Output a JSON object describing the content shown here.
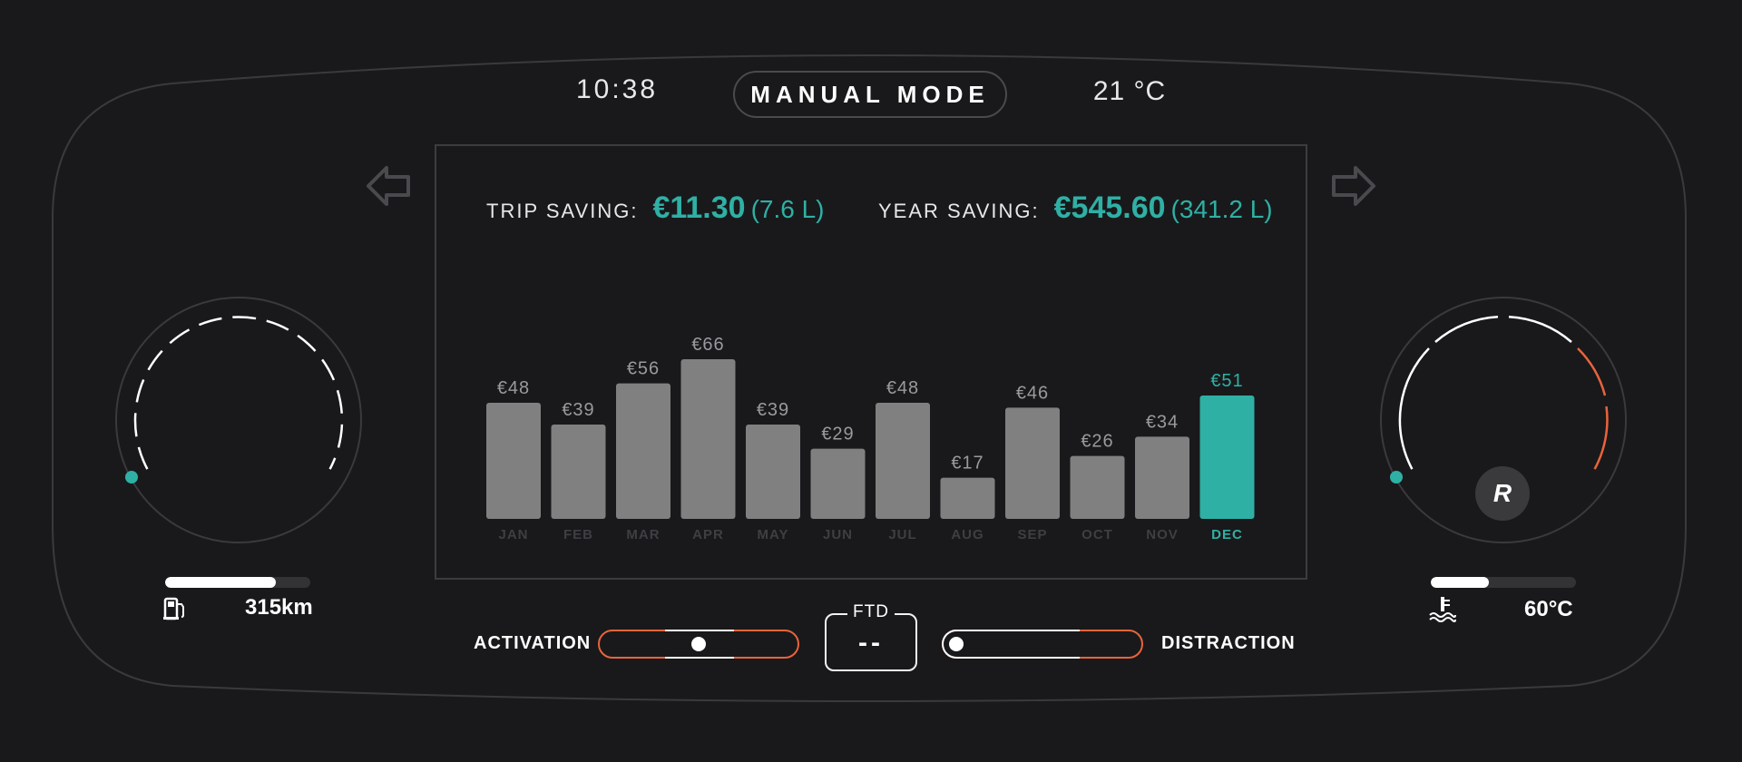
{
  "header": {
    "time": "10:38",
    "mode": "MANUAL MODE",
    "temperature": "21 °C"
  },
  "savings": {
    "trip_label": "TRIP SAVING:",
    "trip_amount": "€11.30",
    "trip_volume": "(7.6 L)",
    "year_label": "YEAR SAVING:",
    "year_amount": "€545.60",
    "year_volume": "(341.2 L)"
  },
  "chart_data": {
    "type": "bar",
    "categories": [
      "JAN",
      "FEB",
      "MAR",
      "APR",
      "MAY",
      "JUN",
      "JUL",
      "AUG",
      "SEP",
      "OCT",
      "NOV",
      "DEC"
    ],
    "values": [
      48,
      39,
      56,
      66,
      39,
      29,
      48,
      17,
      46,
      26,
      34,
      51
    ],
    "value_labels": [
      "€48",
      "€39",
      "€56",
      "€66",
      "€39",
      "€29",
      "€48",
      "€17",
      "€46",
      "€26",
      "€34",
      "€51"
    ],
    "highlight_index": 11,
    "ylim": [
      0,
      66
    ],
    "bar_color": "#808080",
    "highlight_color": "#2fb0a5"
  },
  "left_gauge": {
    "range_fill": 0.76,
    "range_value": "315km",
    "icon": "fuel-pump-icon"
  },
  "right_gauge": {
    "gear": "R",
    "temp_fill": 0.4,
    "temp_value": "60°C",
    "icon": "coolant-temperature-icon"
  },
  "controls": {
    "activation_label": "ACTIVATION",
    "activation_level": 0.5,
    "ftd_label": "FTD",
    "ftd_value": "--",
    "distraction_label": "DISTRACTION",
    "distraction_level": 0.0
  },
  "colors": {
    "accent": "#2fb0a5",
    "warning": "#e8643c",
    "background": "#19191b"
  },
  "icons": {
    "prev": "left-arrow-icon",
    "next": "right-arrow-icon"
  }
}
